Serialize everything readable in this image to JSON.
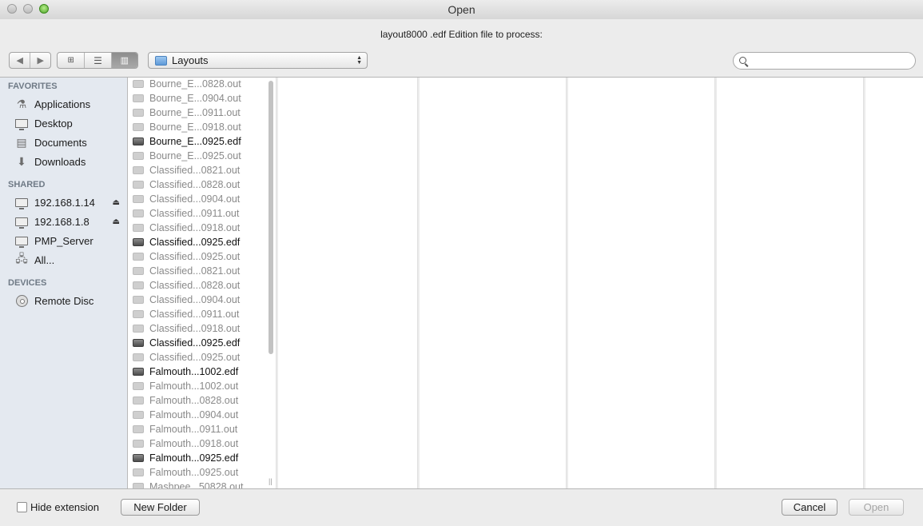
{
  "window": {
    "title": "Open"
  },
  "prompt": "layout8000 .edf Edition file to process:",
  "toolbar": {
    "location": "Layouts",
    "search_placeholder": ""
  },
  "sidebar": {
    "favorites_header": "FAVORITES",
    "favorites": [
      "Applications",
      "Desktop",
      "Documents",
      "Downloads"
    ],
    "shared_header": "SHARED",
    "shared": [
      "192.168.1.14",
      "192.168.1.8",
      "PMP_Server",
      "All..."
    ],
    "devices_header": "DEVICES",
    "devices": [
      "Remote Disc"
    ]
  },
  "files": [
    {
      "name": "Bourne_E...0828.out",
      "edf": false
    },
    {
      "name": "Bourne_E...0904.out",
      "edf": false
    },
    {
      "name": "Bourne_E...0911.out",
      "edf": false
    },
    {
      "name": "Bourne_E...0918.out",
      "edf": false
    },
    {
      "name": "Bourne_E...0925.edf",
      "edf": true
    },
    {
      "name": "Bourne_E...0925.out",
      "edf": false
    },
    {
      "name": "Classified...0821.out",
      "edf": false
    },
    {
      "name": "Classified...0828.out",
      "edf": false
    },
    {
      "name": "Classified...0904.out",
      "edf": false
    },
    {
      "name": "Classified...0911.out",
      "edf": false
    },
    {
      "name": "Classified...0918.out",
      "edf": false
    },
    {
      "name": "Classified...0925.edf",
      "edf": true
    },
    {
      "name": "Classified...0925.out",
      "edf": false
    },
    {
      "name": "Classified...0821.out",
      "edf": false
    },
    {
      "name": "Classified...0828.out",
      "edf": false
    },
    {
      "name": "Classified...0904.out",
      "edf": false
    },
    {
      "name": "Classified...0911.out",
      "edf": false
    },
    {
      "name": "Classified...0918.out",
      "edf": false
    },
    {
      "name": "Classified...0925.edf",
      "edf": true
    },
    {
      "name": "Classified...0925.out",
      "edf": false
    },
    {
      "name": "Falmouth...1002.edf",
      "edf": true
    },
    {
      "name": "Falmouth...1002.out",
      "edf": false
    },
    {
      "name": "Falmouth...0828.out",
      "edf": false
    },
    {
      "name": "Falmouth...0904.out",
      "edf": false
    },
    {
      "name": "Falmouth...0911.out",
      "edf": false
    },
    {
      "name": "Falmouth...0918.out",
      "edf": false
    },
    {
      "name": "Falmouth...0925.edf",
      "edf": true
    },
    {
      "name": "Falmouth...0925.out",
      "edf": false
    },
    {
      "name": "Mashpee...50828.out",
      "edf": false
    }
  ],
  "bottom": {
    "hide_extension_label": "Hide extension",
    "new_folder_label": "New Folder",
    "cancel_label": "Cancel",
    "open_label": "Open"
  }
}
